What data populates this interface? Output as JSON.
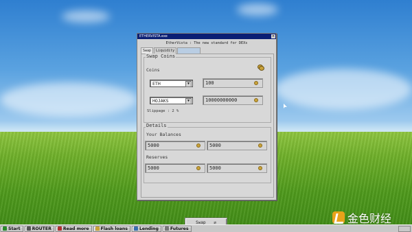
{
  "window": {
    "title": "ETHERVISTA.exe",
    "close": "×",
    "subtitle": "EtherVista : The new standard for DEXs"
  },
  "tabs": [
    {
      "label": "Swap",
      "active": true
    },
    {
      "label": "Liquidity",
      "active": false
    },
    {
      "label": "",
      "active": false
    }
  ],
  "swap": {
    "group_title": "Swap Coins",
    "coins_label": "Coins",
    "from_token": "ETH",
    "from_amount": "100",
    "to_token": "HOJAKS",
    "to_amount": "10000000000",
    "slippage": "Slippage : 2 %"
  },
  "details": {
    "group_title": "Details",
    "balances_label": "Your Balances",
    "balance_1": "5000",
    "balance_2": "5000",
    "reserves_label": "Reserves",
    "reserve_1": "5000",
    "reserve_2": "5000"
  },
  "swap_button": "Swap",
  "taskbar": [
    {
      "label": "Start",
      "icon": "start-icon",
      "color": "#2a8a2a"
    },
    {
      "label": "ROUTER",
      "icon": "router-icon",
      "color": "#555555"
    },
    {
      "label": "Read more",
      "icon": "document-icon",
      "color": "#b03030"
    },
    {
      "label": "Flash loans",
      "icon": "lightning-icon",
      "color": "#c9a23b"
    },
    {
      "label": "Lending",
      "icon": "globe-icon",
      "color": "#3a6fb0"
    },
    {
      "label": "Futures",
      "icon": "chart-icon",
      "color": "#777777"
    }
  ],
  "watermark": "金色财经",
  "colors": {
    "titlebar": "#0b1f74",
    "window_bg": "#d4d4d4",
    "coin_icon": "#c9a23b"
  }
}
